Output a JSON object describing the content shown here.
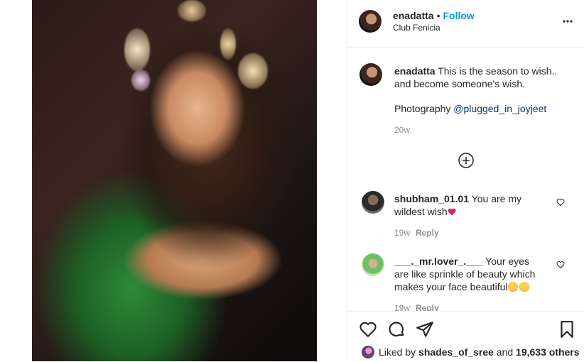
{
  "post": {
    "username": "enadatta",
    "separator": "•",
    "follow_label": "Follow",
    "location": "Club Fenicia",
    "more_icon": "more-horizontal-icon"
  },
  "caption": {
    "username": "enadatta",
    "text_line1": "This is the season to wish..",
    "text_line2": "and become someone's wish.",
    "credit_prefix": "Photography",
    "credit_mention": "@plugged_in_joyjeet",
    "time": "20w"
  },
  "load_more_icon": "plus-circle-icon",
  "comments": [
    {
      "username": "shubham_01.01",
      "text": "You are my wildest wish",
      "time": "19w",
      "reply_label": "Reply"
    },
    {
      "username": "___._mr.lover_.___",
      "text": "Your eyes are like sprinkle of beauty which makes your face beautiful",
      "time": "19w",
      "reply_label": "Reply"
    }
  ],
  "actions": {
    "like_icon": "heart-icon",
    "comment_icon": "comment-icon",
    "share_icon": "send-icon",
    "save_icon": "bookmark-icon"
  },
  "likes": {
    "prefix": "Liked by",
    "user": "shades_of_sree",
    "conjunction": "and",
    "count": "19,633 others"
  },
  "colors": {
    "link": "#0095f6",
    "mention": "#00376b",
    "muted": "#8e8e8e",
    "border": "#efefef"
  }
}
